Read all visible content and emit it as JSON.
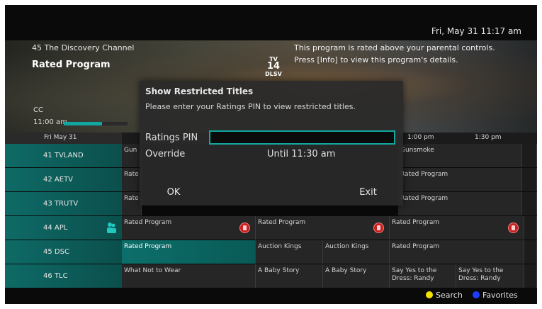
{
  "header": {
    "datetime": "Fri, May 31 11:17 am"
  },
  "info": {
    "channel": "45 The Discovery Channel",
    "title": "Rated Program",
    "rating_top": "TV",
    "rating_mid": "14",
    "rating_sub": "DLSV",
    "message": "This program is rated above your parental controls. Press [Info] to view this program's details.",
    "cc": "CC",
    "time": "11:00 am",
    "progress": 0.6
  },
  "timebar": {
    "date": "Fri May 31",
    "t1": "1:00 pm",
    "t2": "1:30 pm"
  },
  "channels": [
    {
      "label": "41  TVLAND"
    },
    {
      "label": "42  AETV"
    },
    {
      "label": "43  TRUTV"
    },
    {
      "label": "44  APL"
    },
    {
      "label": "45  DSC"
    },
    {
      "label": "46  TLC"
    }
  ],
  "grid": {
    "row1": {
      "a": "Gun",
      "b": "Gunsmoke"
    },
    "row2": {
      "a": "Rate",
      "b": "Rated Program"
    },
    "row3": {
      "a": "Rate",
      "b": "Rated Program"
    },
    "row4": {
      "a": "Rated Program",
      "b": "Rated Program",
      "c": "Rated Program"
    },
    "row5": {
      "a": "Rated Program",
      "b": "Auction Kings",
      "c": "Auction Kings",
      "d": "Rated Program"
    },
    "row6": {
      "a": "What Not to Wear",
      "b": "A Baby Story",
      "c": "A Baby Story",
      "d": "Say Yes to the Dress: Randy",
      "e": "Say Yes to the Dress: Randy"
    }
  },
  "dialog": {
    "title": "Show Restricted Titles",
    "instruction": "Please enter your Ratings PIN to view restricted titles.",
    "pin_label": "Ratings PIN",
    "pin_value": "",
    "override_label": "Override",
    "override_value": "Until 11:30 am",
    "ok_label": "OK",
    "exit_label": "Exit"
  },
  "legend": {
    "search": "Search",
    "search_color": "#f5e100",
    "favorites": "Favorites",
    "favorites_color": "#1e3cff"
  }
}
